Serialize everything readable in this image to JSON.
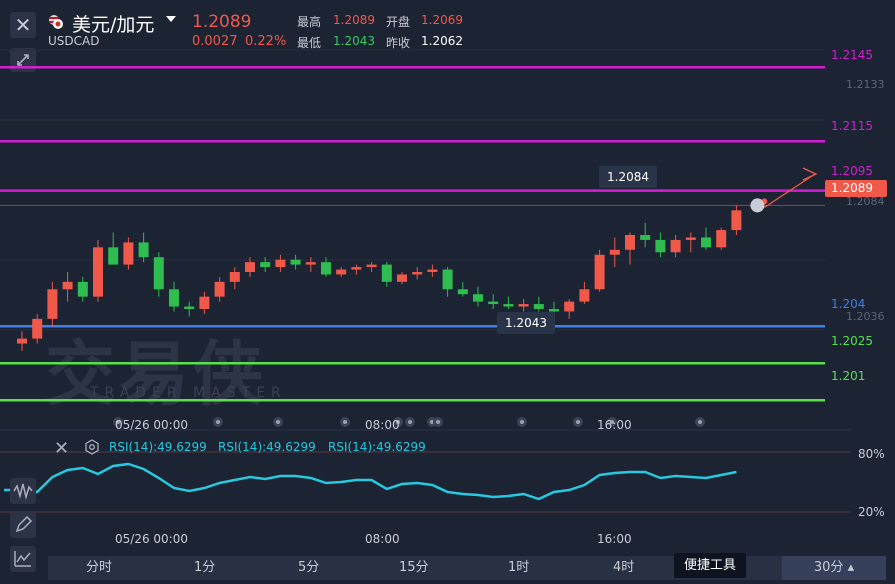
{
  "header": {
    "title": "美元/加元",
    "code": "USDCAD",
    "last_price": "1.2089",
    "change": "0.0027",
    "change_pct": "0.22%",
    "stats": {
      "high_label": "最高",
      "high": "1.2089",
      "open_label": "开盘",
      "open": "1.2069",
      "low_label": "最低",
      "low": "1.2043",
      "prev_close_label": "昨收",
      "prev_close": "1.2062"
    }
  },
  "price_axis": {
    "levels": [
      {
        "value": "1.2145",
        "color": "#d21fd2"
      },
      {
        "value": "1.2115",
        "color": "#d21fd2"
      },
      {
        "value": "1.2095",
        "color": "#d21fd2"
      },
      {
        "value": "1.204",
        "color": "#3f7fe6"
      },
      {
        "value": "1.2025",
        "color": "#58e04f"
      },
      {
        "value": "1.201",
        "color": "#58e04f"
      }
    ],
    "current": "1.2089",
    "faint_ticks": [
      "1.2133",
      "1.2084",
      "1.2036"
    ]
  },
  "annotations": {
    "high_marker": "1.2084",
    "low_marker": "1.2043"
  },
  "watermark": {
    "main": "交易侠",
    "sub": "TRADER MASTER"
  },
  "time_axis": [
    "05/26 00:00",
    "08:00",
    "16:00"
  ],
  "rsi": {
    "labels": [
      "RSI(14):49.6299",
      "RSI(14):49.6299",
      "RSI(14):49.6299"
    ],
    "ticks": [
      "80%",
      "20%"
    ]
  },
  "chart_data": {
    "type": "candlestick",
    "symbol": "USDCAD",
    "ylim": [
      1.2002,
      1.2152
    ],
    "candles": [
      [
        1.2033,
        1.2038,
        1.203,
        1.2035
      ],
      [
        1.2035,
        1.2045,
        1.2033,
        1.2043
      ],
      [
        1.2043,
        1.2058,
        1.204,
        1.2055
      ],
      [
        1.2055,
        1.2062,
        1.205,
        1.2058
      ],
      [
        1.2058,
        1.206,
        1.205,
        1.2052
      ],
      [
        1.2052,
        1.2075,
        1.205,
        1.2072
      ],
      [
        1.2072,
        1.2078,
        1.2068,
        1.2065
      ],
      [
        1.2065,
        1.2076,
        1.2063,
        1.2074
      ],
      [
        1.2074,
        1.2078,
        1.2066,
        1.2068
      ],
      [
        1.2068,
        1.207,
        1.2052,
        1.2055
      ],
      [
        1.2055,
        1.2058,
        1.2046,
        1.2048
      ],
      [
        1.2048,
        1.205,
        1.2044,
        1.2047
      ],
      [
        1.2047,
        1.2054,
        1.2045,
        1.2052
      ],
      [
        1.2052,
        1.206,
        1.205,
        1.2058
      ],
      [
        1.2058,
        1.2064,
        1.2055,
        1.2062
      ],
      [
        1.2062,
        1.2068,
        1.206,
        1.2066
      ],
      [
        1.2066,
        1.2068,
        1.2062,
        1.2064
      ],
      [
        1.2064,
        1.2069,
        1.2062,
        1.2067
      ],
      [
        1.2067,
        1.2069,
        1.2063,
        1.2065
      ],
      [
        1.2065,
        1.2068,
        1.2062,
        1.2066
      ],
      [
        1.2066,
        1.2068,
        1.206,
        1.2061
      ],
      [
        1.2061,
        1.2064,
        1.206,
        1.2063
      ],
      [
        1.2063,
        1.2065,
        1.2061,
        1.2064
      ],
      [
        1.2064,
        1.2066,
        1.2062,
        1.2065
      ],
      [
        1.2065,
        1.2066,
        1.2056,
        1.2058
      ],
      [
        1.2058,
        1.2062,
        1.2057,
        1.2061
      ],
      [
        1.2061,
        1.2064,
        1.2059,
        1.2062
      ],
      [
        1.2062,
        1.2065,
        1.206,
        1.2063
      ],
      [
        1.2063,
        1.2064,
        1.2052,
        1.2055
      ],
      [
        1.2055,
        1.2058,
        1.2052,
        1.2053
      ],
      [
        1.2053,
        1.2056,
        1.2048,
        1.205
      ],
      [
        1.205,
        1.2053,
        1.2047,
        1.2049
      ],
      [
        1.2049,
        1.2052,
        1.2047,
        1.2048
      ],
      [
        1.2048,
        1.2051,
        1.2046,
        1.2049
      ],
      [
        1.2049,
        1.2052,
        1.2046,
        1.2047
      ],
      [
        1.2047,
        1.205,
        1.2044,
        1.2046
      ],
      [
        1.2046,
        1.2051,
        1.2043,
        1.205
      ],
      [
        1.205,
        1.2058,
        1.2049,
        1.2055
      ],
      [
        1.2055,
        1.2071,
        1.2054,
        1.2069
      ],
      [
        1.2069,
        1.2076,
        1.2064,
        1.2071
      ],
      [
        1.2071,
        1.2078,
        1.2065,
        1.2077
      ],
      [
        1.2077,
        1.2082,
        1.2072,
        1.2075
      ],
      [
        1.2075,
        1.2078,
        1.2068,
        1.207
      ],
      [
        1.207,
        1.2077,
        1.2068,
        1.2075
      ],
      [
        1.2075,
        1.2078,
        1.207,
        1.2076
      ],
      [
        1.2076,
        1.208,
        1.2071,
        1.2072
      ],
      [
        1.2072,
        1.208,
        1.2071,
        1.2079
      ],
      [
        1.2079,
        1.2089,
        1.2077,
        1.2087
      ]
    ],
    "rsi_values": [
      42,
      40,
      55,
      62,
      64,
      58,
      66,
      68,
      63,
      54,
      44,
      41,
      44,
      49,
      52,
      55,
      53,
      56,
      56,
      54,
      49,
      50,
      52,
      52,
      43,
      48,
      49,
      47,
      40,
      38,
      37,
      35,
      36,
      38,
      33,
      40,
      42,
      47,
      57,
      59,
      60,
      60,
      54,
      56,
      55,
      54,
      57,
      60
    ]
  },
  "toolbar": {
    "tabs": [
      "分时",
      "1分",
      "5分",
      "15分",
      "1时",
      "4时"
    ],
    "tooltip": "便捷工具",
    "timeframe": "30分"
  }
}
